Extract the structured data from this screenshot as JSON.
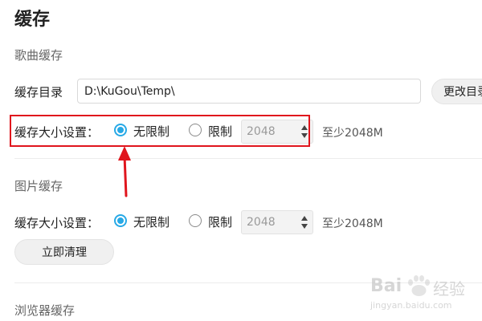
{
  "page_title": "缓存",
  "song_cache": {
    "title": "歌曲缓存",
    "dir_label": "缓存目录",
    "dir_value": "D:\\KuGou\\Temp\\",
    "change_button": "更改目录",
    "size_label": "缓存大小设置：",
    "option_unlimited": "无限制",
    "option_limit": "限制",
    "selected": "无限制",
    "limit_value": "2048",
    "limit_hint": "至少2048M"
  },
  "image_cache": {
    "title": "图片缓存",
    "size_label": "缓存大小设置：",
    "option_unlimited": "无限制",
    "option_limit": "限制",
    "selected": "无限制",
    "limit_value": "2048",
    "limit_hint": "至少2048M",
    "clear_button": "立即清理"
  },
  "browser_cache": {
    "title": "浏览器缓存"
  },
  "annotation": {
    "highlight_color": "#e0151d",
    "arrow_color": "#e0151d"
  },
  "accent_color": "#27a9e6",
  "watermark": {
    "logo_text": "Bai",
    "cn_text": "经验",
    "url_text": "jingyan.baidu.com"
  }
}
